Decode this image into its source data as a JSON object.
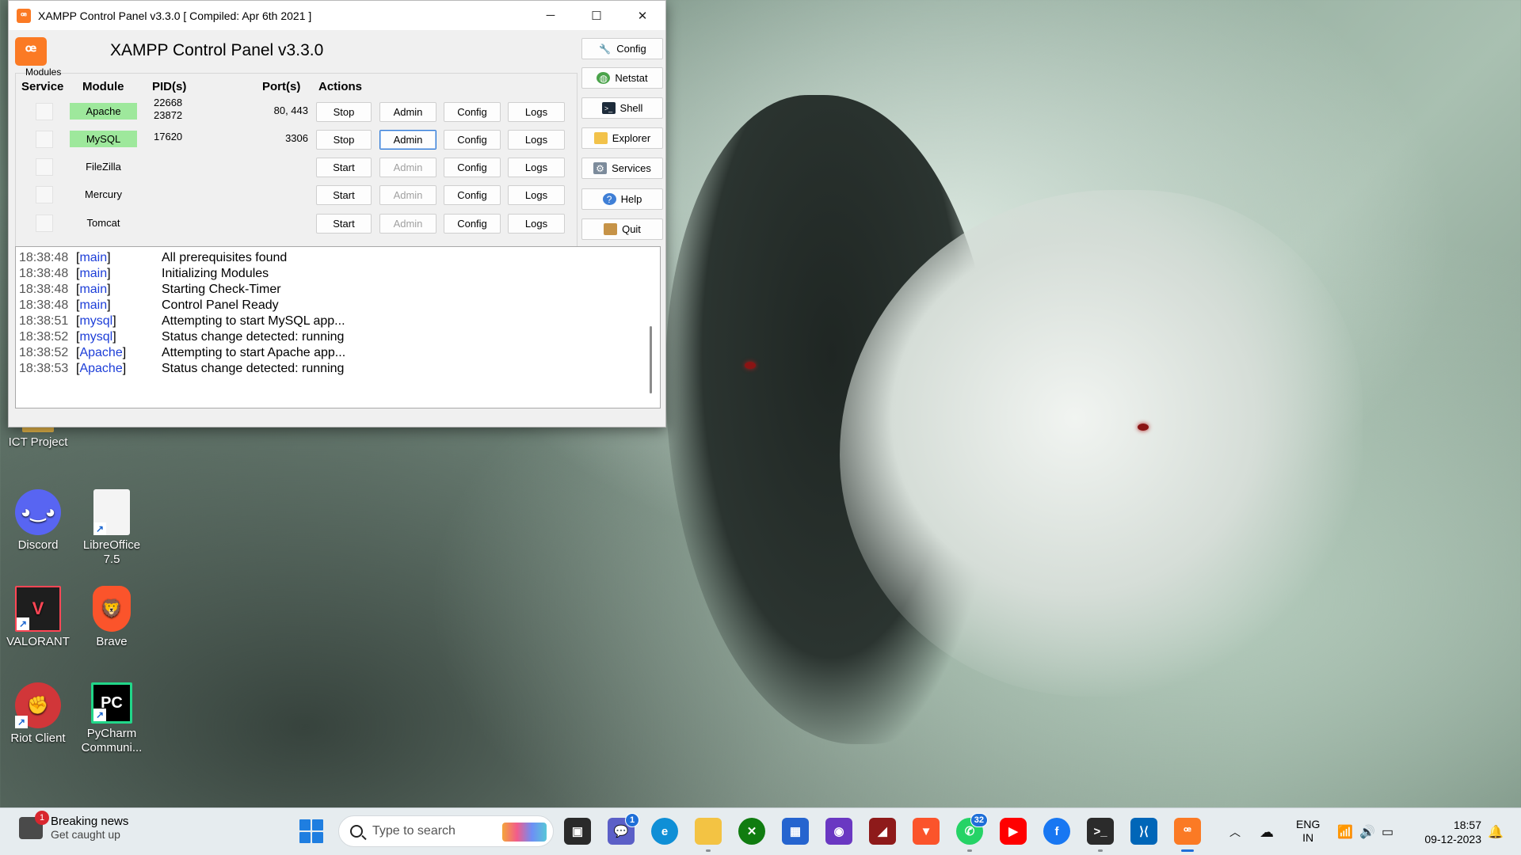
{
  "window": {
    "title": "XAMPP Control Panel v3.3.0   [ Compiled: Apr 6th 2021 ]",
    "app_icon": "xampp-icon",
    "minimize": "─",
    "maximize": "☐",
    "close": "✕"
  },
  "panel": {
    "heading": "XAMPP Control Panel v3.3.0",
    "modules_label": "Modules",
    "headers": {
      "service": "Service",
      "module": "Module",
      "pids": "PID(s)",
      "ports": "Port(s)",
      "actions": "Actions"
    },
    "modules": [
      {
        "name": "Apache",
        "pid1": "22668",
        "pid2": "23872",
        "ports": "80, 443",
        "start_stop": "Stop",
        "admin": "Admin",
        "config": "Config",
        "logs": "Logs",
        "running": true
      },
      {
        "name": "MySQL",
        "pid1": "17620",
        "pid2": "",
        "ports": "3306",
        "start_stop": "Stop",
        "admin": "Admin",
        "config": "Config",
        "logs": "Logs",
        "running": true
      },
      {
        "name": "FileZilla",
        "pid1": "",
        "pid2": "",
        "ports": "",
        "start_stop": "Start",
        "admin": "Admin",
        "config": "Config",
        "logs": "Logs",
        "running": false
      },
      {
        "name": "Mercury",
        "pid1": "",
        "pid2": "",
        "ports": "",
        "start_stop": "Start",
        "admin": "Admin",
        "config": "Config",
        "logs": "Logs",
        "running": false
      },
      {
        "name": "Tomcat",
        "pid1": "",
        "pid2": "",
        "ports": "",
        "start_stop": "Start",
        "admin": "Admin",
        "config": "Config",
        "logs": "Logs",
        "running": false
      }
    ],
    "side_buttons": {
      "config": "Config",
      "netstat": "Netstat",
      "shell": "Shell",
      "explorer": "Explorer",
      "services": "Services",
      "help": "Help",
      "quit": "Quit"
    }
  },
  "log": [
    {
      "time": "18:38:48",
      "module": "main",
      "message": "All prerequisites found"
    },
    {
      "time": "18:38:48",
      "module": "main",
      "message": "Initializing Modules"
    },
    {
      "time": "18:38:48",
      "module": "main",
      "message": "Starting Check-Timer"
    },
    {
      "time": "18:38:48",
      "module": "main",
      "message": "Control Panel Ready"
    },
    {
      "time": "18:38:51",
      "module": "mysql",
      "message": "Attempting to start MySQL app..."
    },
    {
      "time": "18:38:52",
      "module": "mysql",
      "message": "Status change detected: running"
    },
    {
      "time": "18:38:52",
      "module": "Apache",
      "message": "Attempting to start Apache app..."
    },
    {
      "time": "18:38:53",
      "module": "Apache",
      "message": "Status change detected: running"
    }
  ],
  "desktop": {
    "icons": [
      {
        "label": "ICT Project",
        "icon": "folder-icon"
      },
      {
        "label": "Discord",
        "icon": "discord-icon"
      },
      {
        "label": "LibreOffice 7.5",
        "icon": "libreoffice-icon"
      },
      {
        "label": "VALORANT",
        "icon": "valorant-icon"
      },
      {
        "label": "Brave",
        "icon": "brave-icon"
      },
      {
        "label": "Riot Client",
        "icon": "riot-client-icon"
      },
      {
        "label": "PyCharm Communi...",
        "icon": "pycharm-icon"
      }
    ]
  },
  "taskbar": {
    "news_title": "Breaking news",
    "news_subtitle": "Get caught up",
    "news_badge": "1",
    "search_placeholder": "Type to search",
    "teams_badge": "1",
    "whatsapp_badge": "32",
    "language_line1": "ENG",
    "language_line2": "IN",
    "time": "18:57",
    "date": "09-12-2023"
  },
  "colors": {
    "running_module": "#9ee89c",
    "log_module": "#1d3ed8",
    "xampp_orange": "#fb7a24",
    "taskbar_accent": "#1f6fd8"
  }
}
